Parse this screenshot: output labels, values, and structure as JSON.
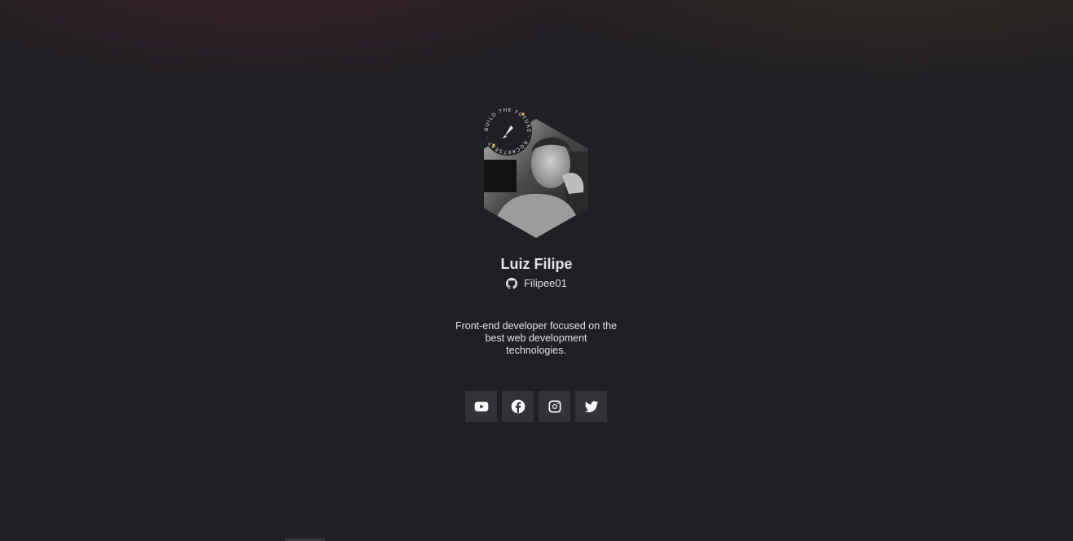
{
  "profile": {
    "name": "Luiz Filipe",
    "github_username": "Filipee01",
    "bio": "Front-end developer focused on the best web development technologies.",
    "avatar_badge_text": "BUILD THE FUTURE · ROCKETSEAT"
  },
  "socials": [
    {
      "name": "YouTube",
      "icon": "youtube-icon"
    },
    {
      "name": "Facebook",
      "icon": "facebook-icon"
    },
    {
      "name": "Instagram",
      "icon": "instagram-icon"
    },
    {
      "name": "Twitter",
      "icon": "twitter-icon"
    }
  ],
  "colors": {
    "background": "#202024",
    "text": "#e1e1e6",
    "button_bg": "#323238",
    "badge_accent": "#f7c948"
  }
}
